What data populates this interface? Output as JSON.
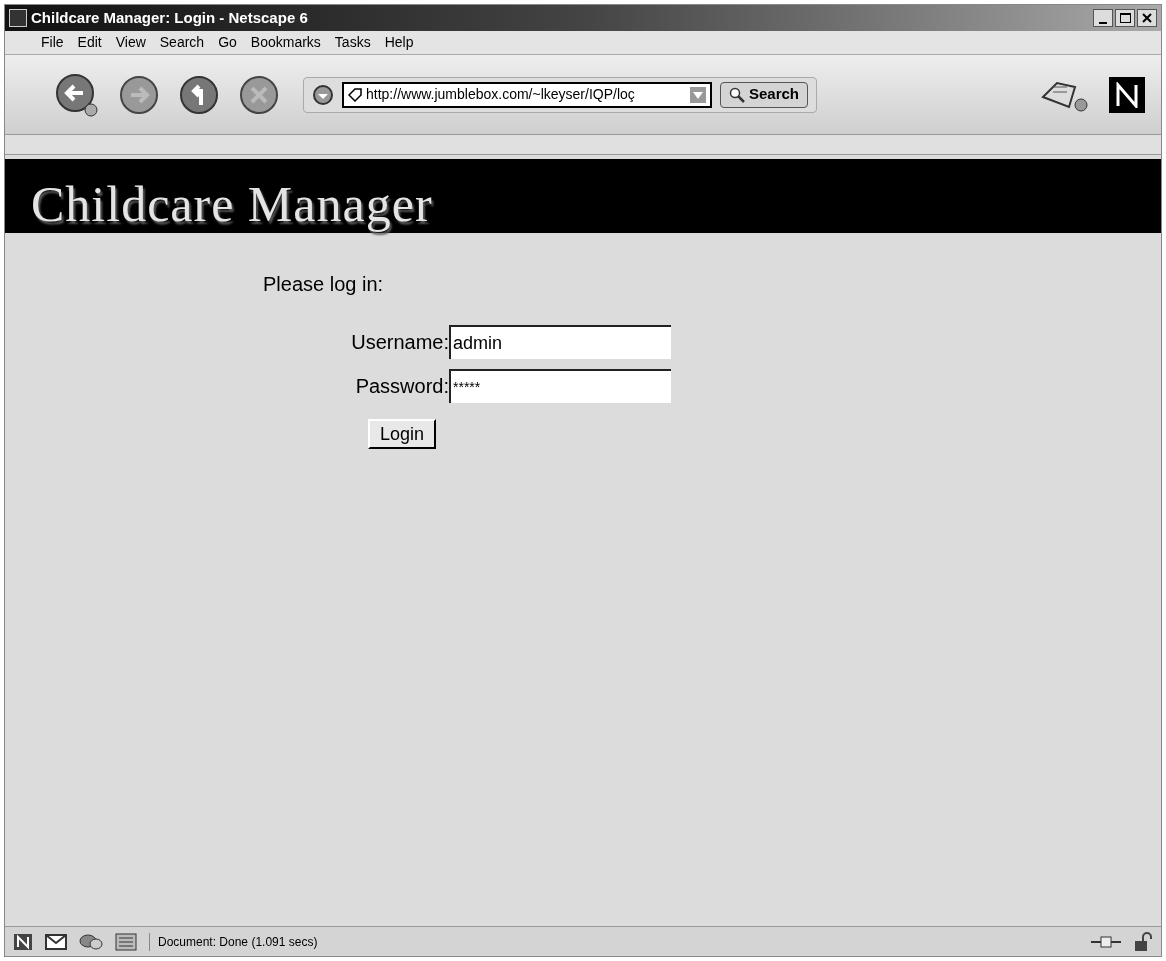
{
  "window": {
    "title": "Childcare Manager: Login - Netscape 6"
  },
  "menu": [
    "File",
    "Edit",
    "View",
    "Search",
    "Go",
    "Bookmarks",
    "Tasks",
    "Help"
  ],
  "toolbar": {
    "address": "http://www.jumblebox.com/~lkeyser/IQP/loç",
    "search_button": "Search"
  },
  "page": {
    "banner": "Childcare Manager",
    "prompt": "Please log in:",
    "fields": [
      {
        "label": "Username:",
        "value": "admin",
        "kind": "text"
      },
      {
        "label": "Password:",
        "value": "*****",
        "kind": "password"
      }
    ],
    "button": "Login"
  },
  "status_bar": {
    "text": "Document: Done (1.091 secs)"
  }
}
